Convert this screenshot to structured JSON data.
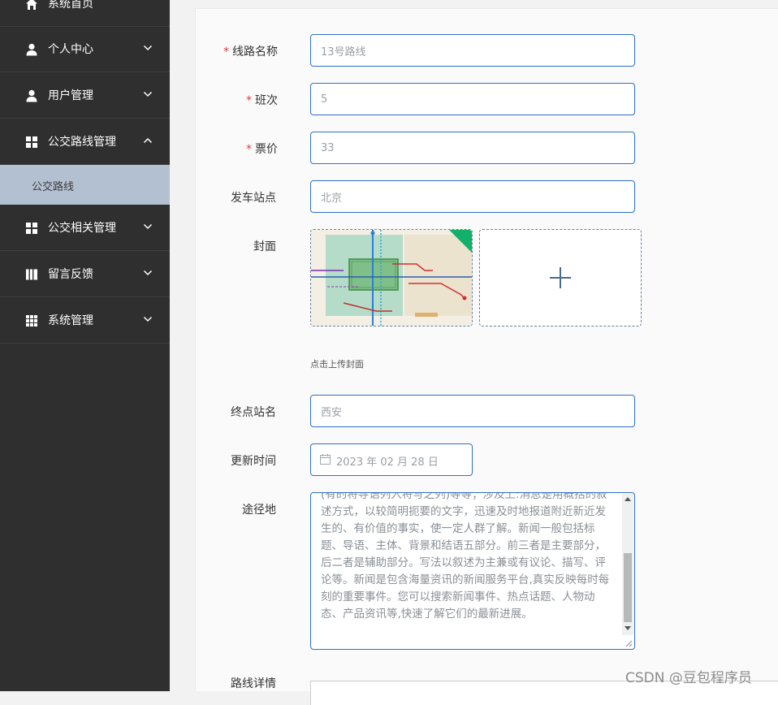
{
  "sidebar": {
    "items": [
      {
        "label": "系统首页",
        "icon": "home-icon"
      },
      {
        "label": "个人中心",
        "icon": "user-icon"
      },
      {
        "label": "用户管理",
        "icon": "user-icon"
      },
      {
        "label": "公交路线管理",
        "icon": "grid-icon"
      },
      {
        "label": "公交相关管理",
        "icon": "grid-icon"
      },
      {
        "label": "留言反馈",
        "icon": "book-icon"
      },
      {
        "label": "系统管理",
        "icon": "apps-icon"
      }
    ],
    "active_sub_item": "公交路线"
  },
  "form": {
    "route_name": {
      "label": "线路名称",
      "required": true,
      "value": "13号路线"
    },
    "shift": {
      "label": "班次",
      "required": true,
      "value": "5"
    },
    "fare": {
      "label": "票价",
      "required": true,
      "value": "33"
    },
    "start_station": {
      "label": "发车站点",
      "value": "北京"
    },
    "cover": {
      "label": "封面",
      "tip": "点击上传封面"
    },
    "end_station": {
      "label": "终点站名",
      "value": "西安"
    },
    "update_time": {
      "label": "更新时间",
      "value": "2023 年 02 月 28 日"
    },
    "waypoints": {
      "label": "途径地",
      "value": "(有的将导语列入将写之列)等等；涉及上:消息是用概括的叙述方式，以较简明扼要的文字，迅速及时地报道附近新近发生的、有价值的事实，使一定人群了解。新闻一般包括标题、导语、主体、背景和结语五部分。前三者是主要部分，后二者是辅助部分。写法以叙述为主兼或有议论、描写、评论等。新闻是包含海量资讯的新闻服务平台,真实反映每时每刻的重要事件。您可以搜索新闻事件、热点话题、人物动态、产品资讯等,快速了解它们的最新进展。"
    },
    "route_details": {
      "label": "路线详情"
    }
  },
  "watermark": "CSDN @豆包程序员",
  "colors": {
    "sidebar_bg": "#2f2f2f",
    "sidebar_active_bg": "#b3c0d1",
    "input_border": "#2d70c8",
    "required": "#e83b3b"
  }
}
